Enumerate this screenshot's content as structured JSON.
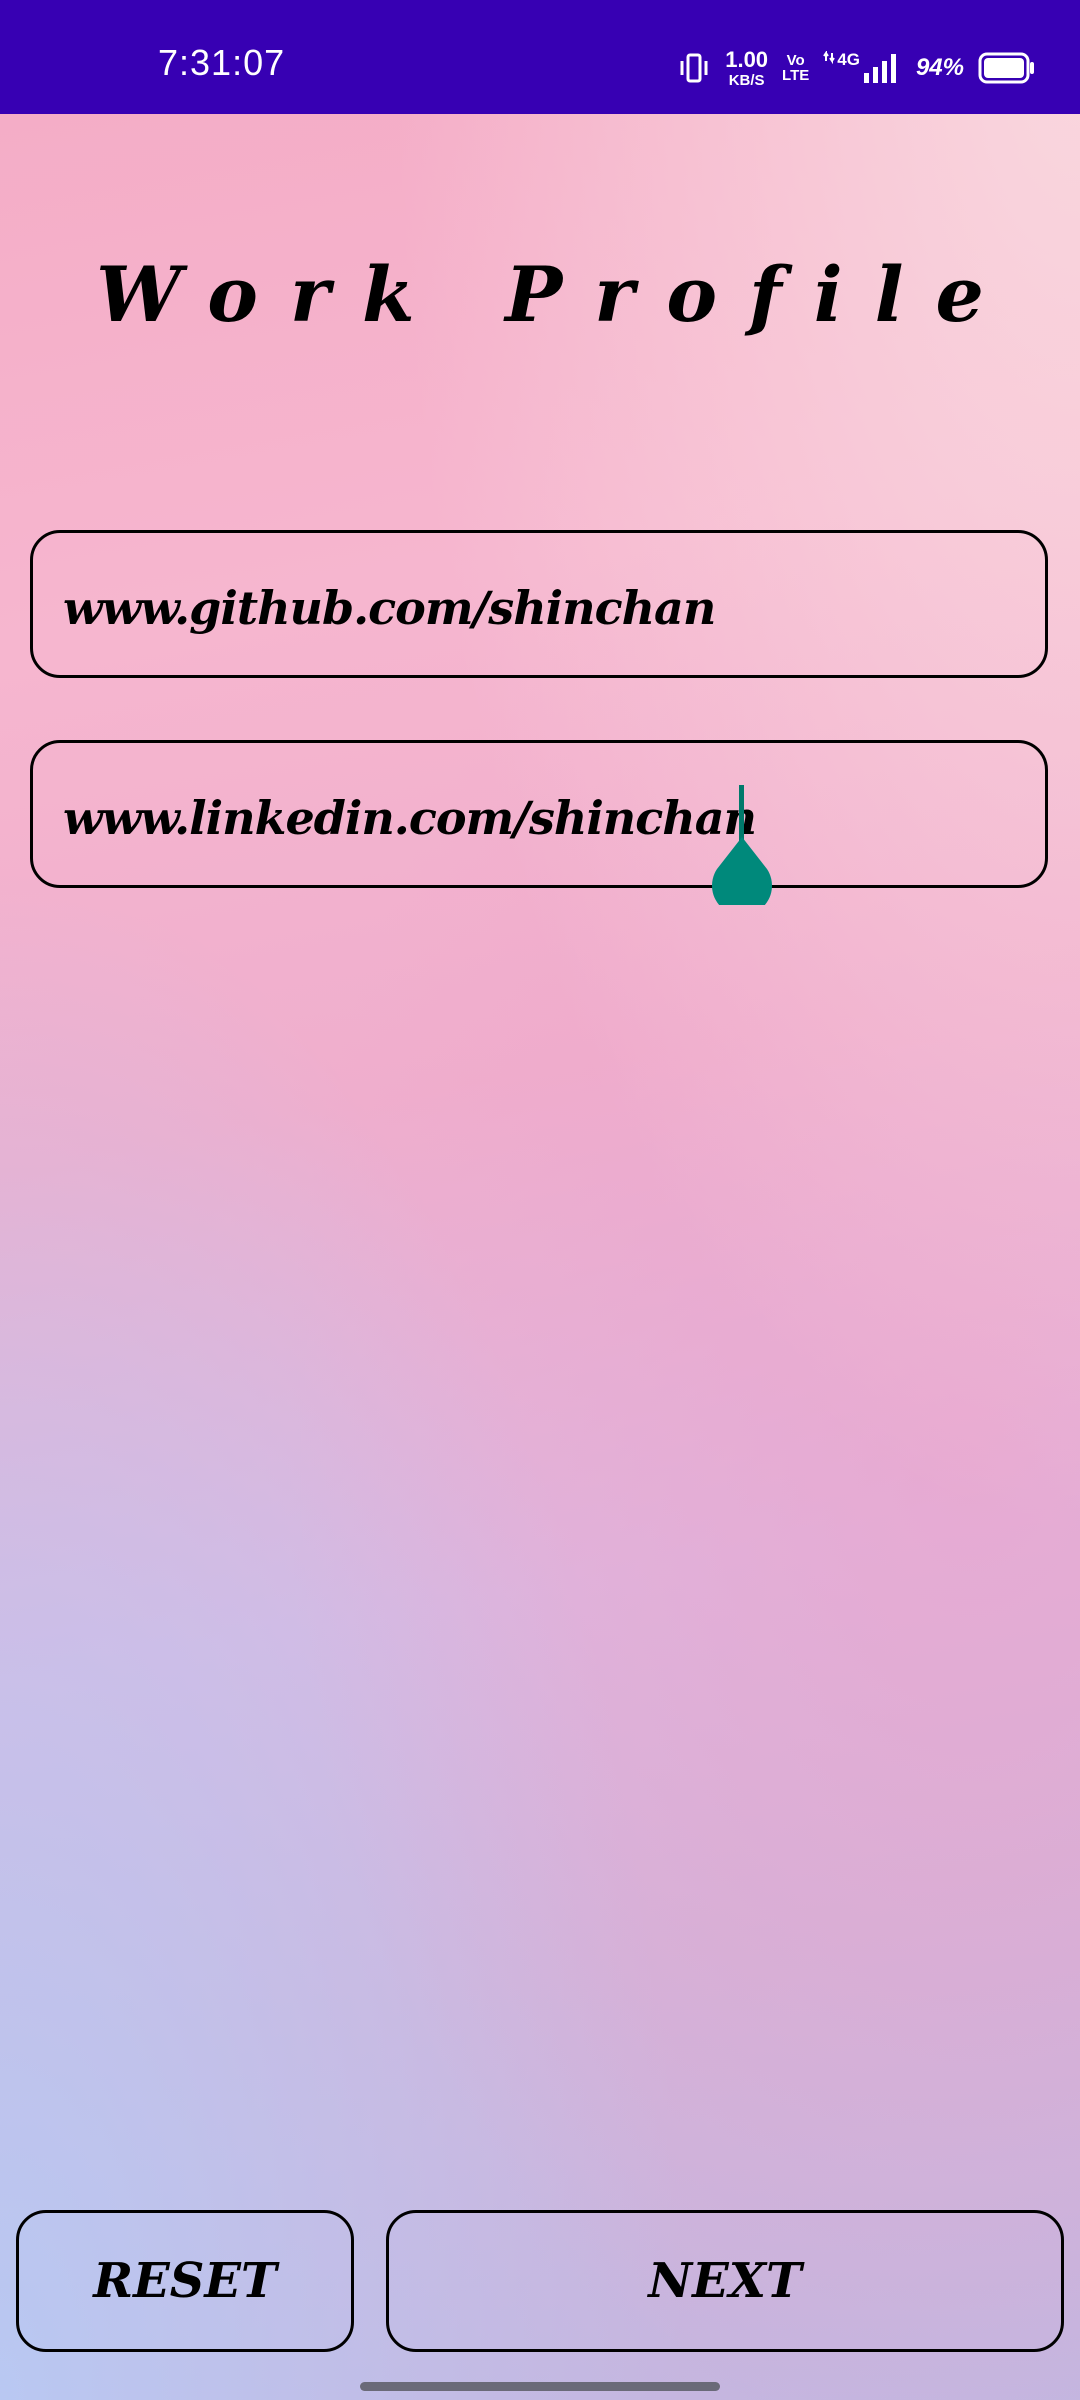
{
  "status_bar": {
    "time": "7:31:07",
    "net_speed_value": "1.00",
    "net_speed_unit": "KB/S",
    "volte_top": "Vo",
    "volte_bottom": "LTE",
    "network": "4G",
    "battery_percent": "94%",
    "background_color": "#3700b3"
  },
  "page": {
    "title": "Work Profile"
  },
  "fields": {
    "github_value": "www.github.com/shinchan",
    "linkedin_value": "www.linkedin.com/shinchan"
  },
  "buttons": {
    "reset_label": "RESET",
    "next_label": "NEXT"
  },
  "colors": {
    "accent": "#00897b",
    "border": "#000000"
  }
}
